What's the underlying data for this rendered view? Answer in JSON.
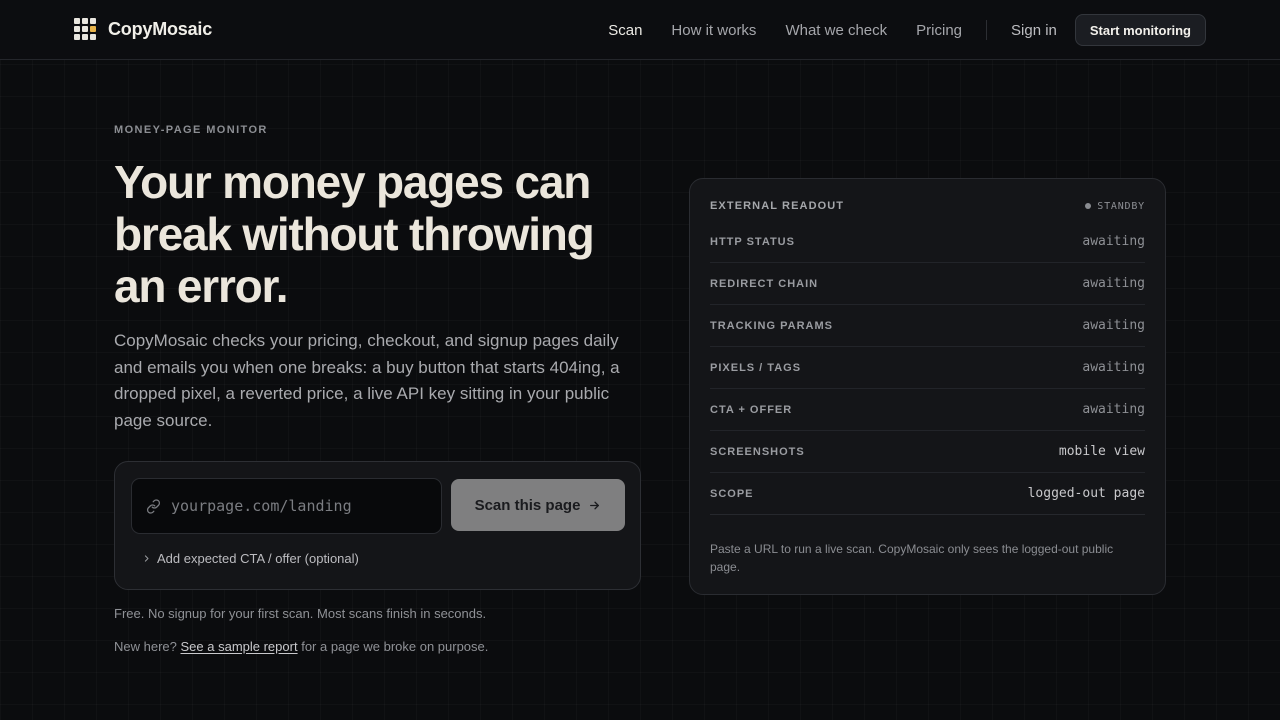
{
  "app": {
    "name": "CopyMosaic"
  },
  "nav": {
    "links": [
      "Scan",
      "How it works",
      "What we check",
      "Pricing"
    ],
    "active": "Scan",
    "signin": "Sign in",
    "cta": "Start monitoring"
  },
  "hero": {
    "eyebrow": "MONEY-PAGE MONITOR",
    "title": "Your money pages can break without throwing an error.",
    "description": "CopyMosaic checks your pricing, checkout, and signup pages daily and emails you when one breaks: a buy button that starts 404ing, a dropped pixel, a reverted price, a live API key sitting in your public page source."
  },
  "scan": {
    "placeholder": "yourpage.com/landing",
    "value": "",
    "button": "Scan this page",
    "expected_toggle": "Add expected CTA / offer (optional)"
  },
  "notes": {
    "free": "Free. No signup for your first scan. Most scans finish in seconds.",
    "sample_prefix": "New here?",
    "sample_link": "See a sample report",
    "sample_suffix": "for a page we broke on purpose."
  },
  "readout": {
    "title": "EXTERNAL READOUT",
    "status": "STANDBY",
    "rows": [
      {
        "label": "HTTP STATUS",
        "value": "awaiting"
      },
      {
        "label": "REDIRECT CHAIN",
        "value": "awaiting"
      },
      {
        "label": "TRACKING PARAMS",
        "value": "awaiting"
      },
      {
        "label": "PIXELS / TAGS",
        "value": "awaiting"
      },
      {
        "label": "CTA + OFFER",
        "value": "awaiting"
      },
      {
        "label": "SCREENSHOTS",
        "value": "mobile view"
      },
      {
        "label": "SCOPE",
        "value": "logged-out page"
      }
    ],
    "footer": "Paste a URL to run a live scan. CopyMosaic only sees the logged-out public page."
  },
  "colors": {
    "background": "#0b0c0e",
    "logo_accent": "#e9b44a",
    "scan_button": "#7f7f80",
    "headline": "#ebe6dc"
  },
  "icons": [
    "logo-grid-icon",
    "link-icon",
    "arrow-right-icon",
    "chevron-right-icon",
    "status-dot-icon"
  ]
}
